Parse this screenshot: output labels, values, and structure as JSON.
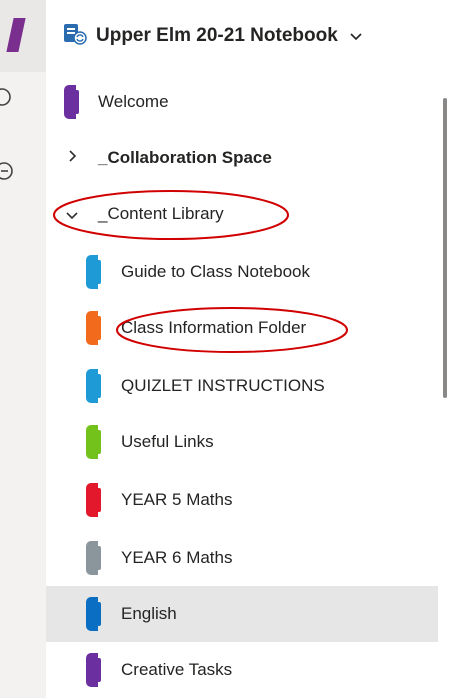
{
  "header": {
    "title": "Upper Elm 20-21 Notebook"
  },
  "colors": {
    "rail_accent": "#7a2e8e",
    "selected_bg": "#e6e6e6",
    "annotation": "#d10000"
  },
  "icons": {
    "notebook": "notebook-sync-icon",
    "dropdown": "chevron-down-icon"
  },
  "sections": [
    {
      "label": "Welcome",
      "color": "#6b2fa0"
    }
  ],
  "groups": [
    {
      "label": "_Collaboration Space",
      "expanded": false
    },
    {
      "label": "_Content Library",
      "expanded": true
    }
  ],
  "library_sections": [
    {
      "label": "Guide to Class Notebook",
      "color": "#1e9ad6"
    },
    {
      "label": "Class Information Folder",
      "color": "#f26a1b"
    },
    {
      "label": "QUIZLET INSTRUCTIONS",
      "color": "#1e9ad6"
    },
    {
      "label": "Useful Links",
      "color": "#72c21b"
    },
    {
      "label": "YEAR 5 Maths",
      "color": "#e3182d"
    },
    {
      "label": "YEAR 6 Maths",
      "color": "#8b969c"
    },
    {
      "label": "English",
      "color": "#0a6fc2",
      "selected": true
    },
    {
      "label": "Creative Tasks",
      "color": "#6b2fa0"
    }
  ]
}
